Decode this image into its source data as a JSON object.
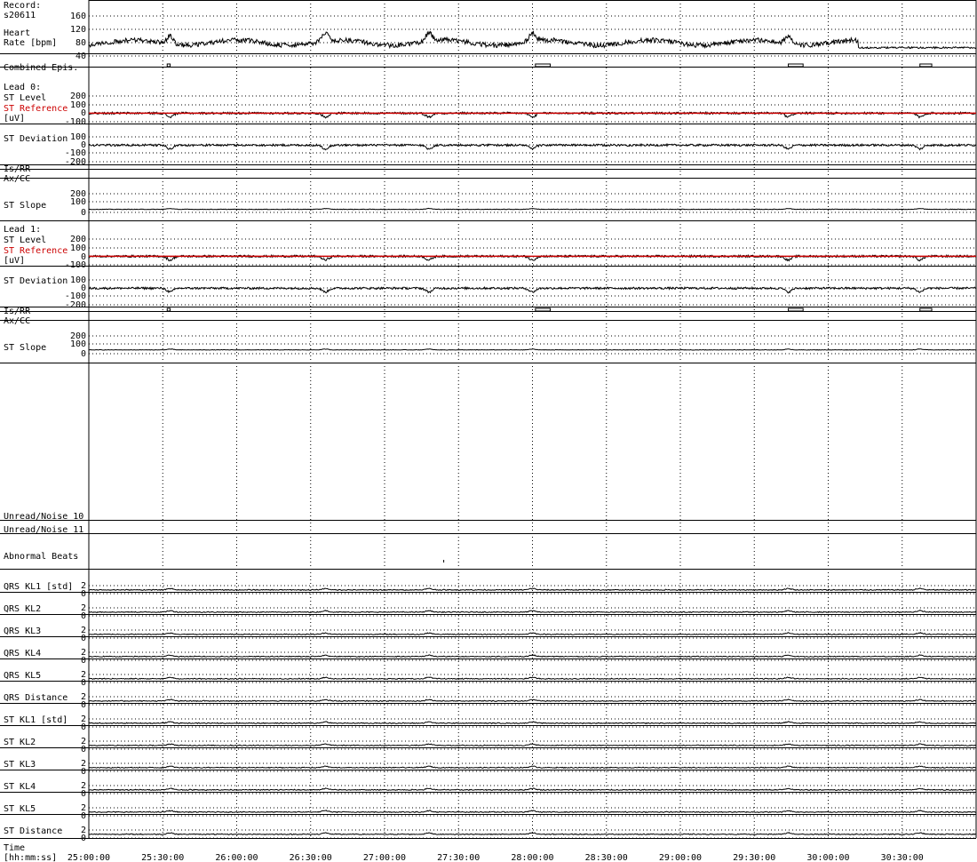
{
  "record": {
    "label": "Record:",
    "id": "s20611"
  },
  "time_axis": {
    "label_line1": "Time",
    "label_line2": "[hh:mm:ss]",
    "ticks": [
      "25:00:00",
      "25:30:00",
      "26:00:00",
      "26:30:00",
      "27:00:00",
      "27:30:00",
      "28:00:00",
      "28:30:00",
      "29:00:00",
      "29:30:00",
      "30:00:00",
      "30:30:00"
    ]
  },
  "colors": {
    "trace": "#000000",
    "reference": "#cc0000",
    "grid": "#000000"
  },
  "chart_data": {
    "type": "line",
    "x_range": [
      "25:00:00",
      "31:00:00"
    ],
    "grid": true,
    "panels": [
      {
        "id": "hr",
        "labels": [
          "Heart",
          "Rate [bpm]"
        ],
        "ticks": [
          "160",
          "120",
          "80",
          "40"
        ],
        "ylim": [
          40,
          160
        ],
        "series": [
          {
            "kind": "heart_rate",
            "base": 80
          }
        ]
      },
      {
        "id": "combined",
        "labels": [
          "Combined Epis."
        ],
        "ticks": [],
        "episodes": [
          [
            25.53,
            25.55
          ],
          [
            28.02,
            28.12
          ],
          [
            29.73,
            29.83
          ],
          [
            30.62,
            30.7
          ]
        ]
      },
      {
        "id": "l0_level",
        "labels": [
          "Lead 0:",
          "ST Level",
          "ST Reference",
          "[uV]"
        ],
        "label_colors": [
          "",
          "",
          "#cc0000",
          ""
        ],
        "ticks": [
          "200",
          "100",
          "0",
          "-100"
        ],
        "ylim": [
          -100,
          200
        ],
        "series": [
          {
            "kind": "st",
            "base": 0
          },
          {
            "kind": "ref",
            "value": 0
          }
        ]
      },
      {
        "id": "l0_dev",
        "labels": [
          "ST Deviation"
        ],
        "ticks": [
          "100",
          "0",
          "-100",
          "-200"
        ],
        "ylim": [
          -200,
          100
        ],
        "series": [
          {
            "kind": "st",
            "base": 0
          }
        ]
      },
      {
        "id": "l0_isrr",
        "labels": [
          "Is/RR"
        ],
        "ticks": []
      },
      {
        "id": "l0_axcc",
        "labels": [
          "Ax/CC"
        ],
        "ticks": []
      },
      {
        "id": "l0_slope",
        "labels": [
          "ST Slope"
        ],
        "ticks": [
          "200",
          "100",
          "0"
        ],
        "ylim": [
          0,
          200
        ],
        "series": [
          {
            "kind": "slope",
            "base": 0
          }
        ]
      },
      {
        "id": "l1_level",
        "labels": [
          "Lead 1:",
          "ST Level",
          "ST Reference",
          "[uV]"
        ],
        "label_colors": [
          "",
          "",
          "#cc0000",
          ""
        ],
        "ticks": [
          "200",
          "100",
          "0",
          "-100"
        ],
        "ylim": [
          -100,
          200
        ],
        "series": [
          {
            "kind": "st",
            "base": 0
          },
          {
            "kind": "ref",
            "value": 0
          }
        ]
      },
      {
        "id": "l1_dev",
        "labels": [
          "ST Deviation"
        ],
        "ticks": [
          "100",
          "0",
          "-100",
          "-200"
        ],
        "ylim": [
          -200,
          100
        ],
        "series": [
          {
            "kind": "st",
            "base": 0
          }
        ]
      },
      {
        "id": "l1_isrr",
        "labels": [
          "Is/RR"
        ],
        "ticks": [],
        "episodes": [
          [
            25.53,
            25.55
          ],
          [
            28.02,
            28.12
          ],
          [
            29.73,
            29.83
          ],
          [
            30.62,
            30.7
          ]
        ]
      },
      {
        "id": "l1_axcc",
        "labels": [
          "Ax/CC"
        ],
        "ticks": []
      },
      {
        "id": "l1_slope",
        "labels": [
          "ST Slope"
        ],
        "ticks": [
          "200",
          "100",
          "0"
        ],
        "ylim": [
          0,
          200
        ],
        "series": [
          {
            "kind": "slope",
            "base": 10
          }
        ]
      },
      {
        "id": "noise10",
        "labels": [
          "Unread/Noise 10"
        ],
        "ticks": []
      },
      {
        "id": "noise11",
        "labels": [
          "Unread/Noise 11"
        ],
        "ticks": []
      },
      {
        "id": "abnormal",
        "labels": [
          "Abnormal Beats"
        ],
        "ticks": [],
        "events": [
          27.4
        ]
      },
      {
        "id": "qkl1",
        "labels": [
          "QRS KL1 [std]"
        ],
        "ticks": [
          "2",
          "0"
        ],
        "ylim": [
          0,
          2
        ],
        "series": [
          {
            "kind": "kl"
          }
        ]
      },
      {
        "id": "qkl2",
        "labels": [
          "QRS KL2"
        ],
        "ticks": [
          "2",
          "0"
        ],
        "ylim": [
          0,
          2
        ],
        "series": [
          {
            "kind": "kl"
          }
        ]
      },
      {
        "id": "qkl3",
        "labels": [
          "QRS KL3"
        ],
        "ticks": [
          "2",
          "0"
        ],
        "ylim": [
          0,
          2
        ],
        "series": [
          {
            "kind": "kl"
          }
        ]
      },
      {
        "id": "qkl4",
        "labels": [
          "QRS KL4"
        ],
        "ticks": [
          "2",
          "0"
        ],
        "ylim": [
          0,
          2
        ],
        "series": [
          {
            "kind": "kl"
          }
        ]
      },
      {
        "id": "qkl5",
        "labels": [
          "QRS KL5"
        ],
        "ticks": [
          "2",
          "0"
        ],
        "ylim": [
          0,
          2
        ],
        "series": [
          {
            "kind": "kl"
          }
        ]
      },
      {
        "id": "qdist",
        "labels": [
          "QRS Distance"
        ],
        "ticks": [
          "2",
          "0"
        ],
        "ylim": [
          0,
          2
        ],
        "series": [
          {
            "kind": "kl"
          }
        ]
      },
      {
        "id": "skl1",
        "labels": [
          "ST KL1 [std]"
        ],
        "ticks": [
          "2",
          "0"
        ],
        "ylim": [
          0,
          2
        ],
        "series": [
          {
            "kind": "kl"
          }
        ]
      },
      {
        "id": "skl2",
        "labels": [
          "ST KL2"
        ],
        "ticks": [
          "2",
          "0"
        ],
        "ylim": [
          0,
          2
        ],
        "series": [
          {
            "kind": "kl"
          }
        ]
      },
      {
        "id": "skl3",
        "labels": [
          "ST KL3"
        ],
        "ticks": [
          "2",
          "0"
        ],
        "ylim": [
          0,
          2
        ],
        "series": [
          {
            "kind": "kl"
          }
        ]
      },
      {
        "id": "skl4",
        "labels": [
          "ST KL4"
        ],
        "ticks": [
          "2",
          "0"
        ],
        "ylim": [
          0,
          2
        ],
        "series": [
          {
            "kind": "kl"
          }
        ]
      },
      {
        "id": "skl5",
        "labels": [
          "ST KL5"
        ],
        "ticks": [
          "2",
          "0"
        ],
        "ylim": [
          0,
          2
        ],
        "series": [
          {
            "kind": "kl"
          }
        ]
      },
      {
        "id": "sdist",
        "labels": [
          "ST Distance"
        ],
        "ticks": [
          "2",
          "0"
        ],
        "ylim": [
          0,
          2
        ],
        "series": [
          {
            "kind": "kl"
          }
        ]
      }
    ]
  }
}
